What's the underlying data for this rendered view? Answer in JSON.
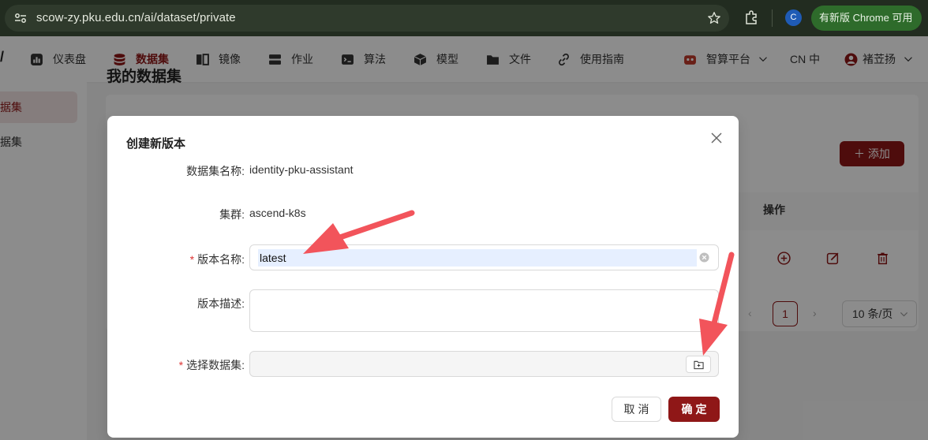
{
  "browser": {
    "url": "scow-zy.pku.edu.cn/ai/dataset/private",
    "profile_initial": "C",
    "update_label": "有新版 Chrome 可用"
  },
  "nav": {
    "logo_fragment": "/",
    "items": [
      {
        "label": "仪表盘",
        "icon": "dashboard-icon"
      },
      {
        "label": "数据集",
        "icon": "database-icon",
        "active": true
      },
      {
        "label": "镜像",
        "icon": "image-icon"
      },
      {
        "label": "作业",
        "icon": "job-icon"
      },
      {
        "label": "算法",
        "icon": "algorithm-icon"
      },
      {
        "label": "模型",
        "icon": "model-icon"
      },
      {
        "label": "文件",
        "icon": "folder-icon"
      },
      {
        "label": "使用指南",
        "icon": "link-icon"
      }
    ],
    "platform": "智算平台",
    "language": "CN 中",
    "user": "褚苙扬"
  },
  "sidebar": {
    "items": [
      {
        "label": "据集",
        "active": true
      },
      {
        "label": "据集",
        "active": false
      }
    ]
  },
  "main": {
    "title": "我的数据集",
    "add_label": "添加",
    "action_header": "操作",
    "pagination": {
      "current": "1",
      "page_size": "10 条/页"
    }
  },
  "modal": {
    "title": "创建新版本",
    "fields": {
      "dataset_name_label": "数据集名称:",
      "dataset_name_value": "identity-pku-assistant",
      "cluster_label": "集群:",
      "cluster_value": "ascend-k8s",
      "version_name_label": "版本名称:",
      "version_name_value": "latest",
      "version_desc_label": "版本描述:",
      "select_dataset_label": "选择数据集:"
    },
    "cancel_label": "取消",
    "ok_label": "确定"
  },
  "colors": {
    "brand": "#8f1717",
    "annotation_arrow": "#f2545b"
  }
}
